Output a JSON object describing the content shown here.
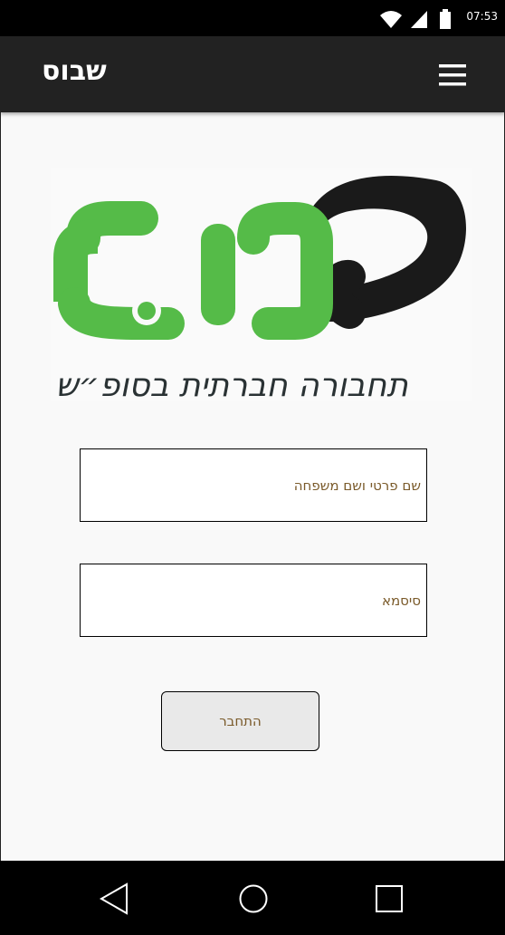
{
  "status_bar": {
    "time": "07:53",
    "icons": [
      "wifi-icon",
      "signal-icon",
      "battery-icon"
    ]
  },
  "app_bar": {
    "title": "שבוס",
    "menu_icon": "hamburger-menu-icon"
  },
  "logo": {
    "wordmark": "שבוס",
    "tagline": "תחבורה חברתית בסופ״ש",
    "colors": {
      "green": "#55bb48",
      "black": "#1a1a1a"
    }
  },
  "login_form": {
    "name_placeholder": "שם פרטי ושם משפחה",
    "password_placeholder": "סיסמא",
    "submit_label": "התחבר"
  },
  "nav_bar": {
    "icons": [
      "back-icon",
      "home-icon",
      "recent-apps-icon"
    ]
  },
  "colors": {
    "app_bar": "#222222",
    "background": "#f9f9f9",
    "placeholder_text": "#7a5a2a",
    "button_bg": "#e9e9e9"
  }
}
